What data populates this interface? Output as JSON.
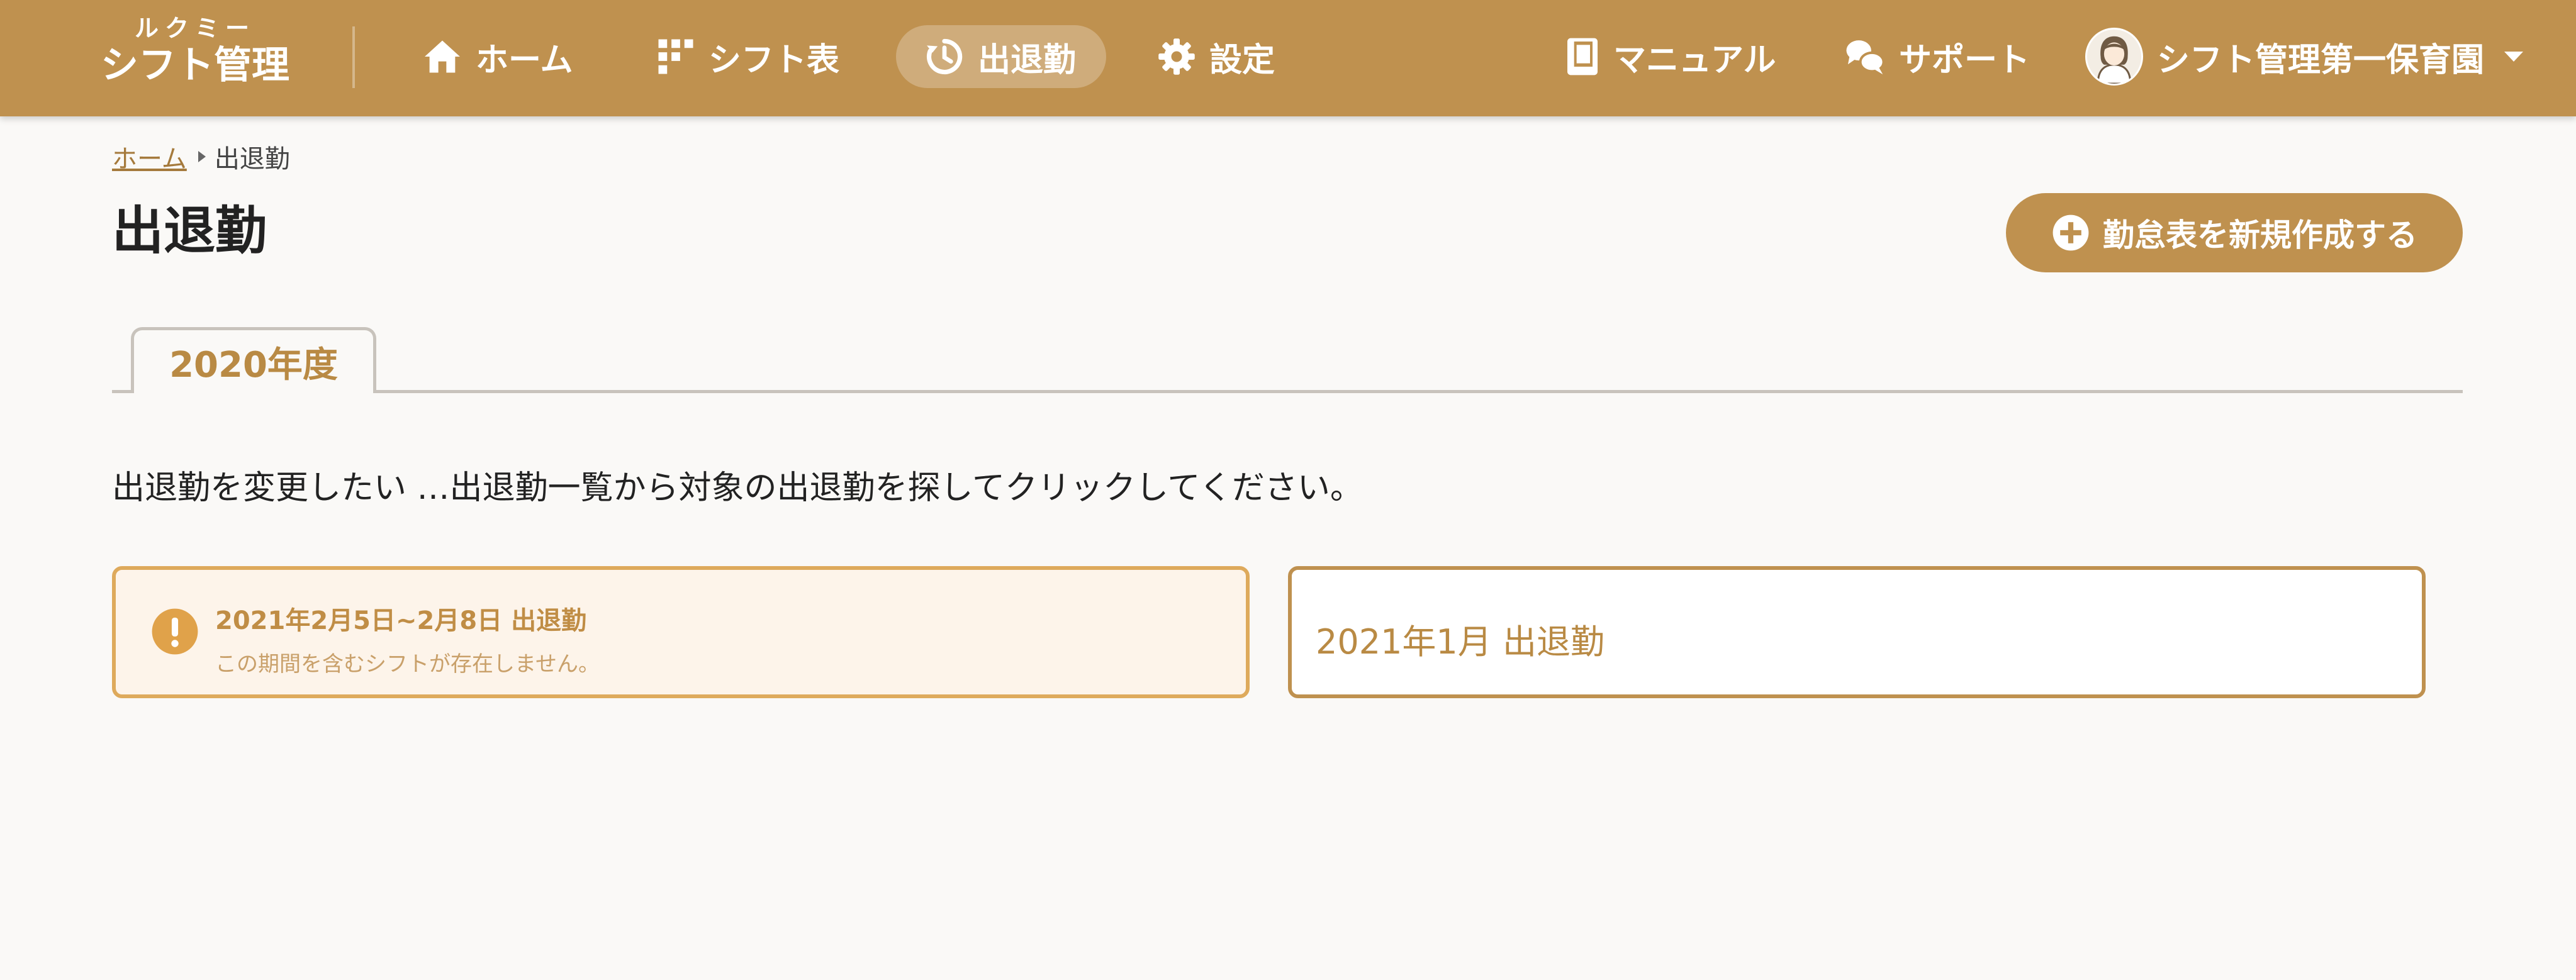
{
  "header": {
    "logo_small": "ルクミー",
    "logo_main": "シフト管理",
    "nav": [
      {
        "label": "ホーム",
        "icon": "home-icon"
      },
      {
        "label": "シフト表",
        "icon": "grid-icon"
      },
      {
        "label": "出退勤",
        "icon": "clock-icon",
        "active": true
      },
      {
        "label": "設定",
        "icon": "gear-icon"
      }
    ],
    "manual_label": "マニュアル",
    "support_label": "サポート",
    "org_name": "シフト管理第一保育園"
  },
  "breadcrumb": {
    "home": "ホーム",
    "current": "出退勤"
  },
  "page": {
    "title": "出退勤",
    "new_button": "勤怠表を新規作成する",
    "tab": "2020年度",
    "help_text": "出退勤を変更したい …出退勤一覧から対象の出退勤を探してクリックしてください。"
  },
  "records": [
    {
      "title": "2021年2月5日~2月8日 出退勤",
      "note": "この期間を含むシフトが存在しません。",
      "status": "warning"
    },
    {
      "title": "2021年1月 出退勤",
      "status": "normal"
    }
  ],
  "colors": {
    "brand": "#bf914f",
    "warning_border": "#deaa5c",
    "warning_bg": "#fdf4ea",
    "background": "#faf9f7"
  }
}
